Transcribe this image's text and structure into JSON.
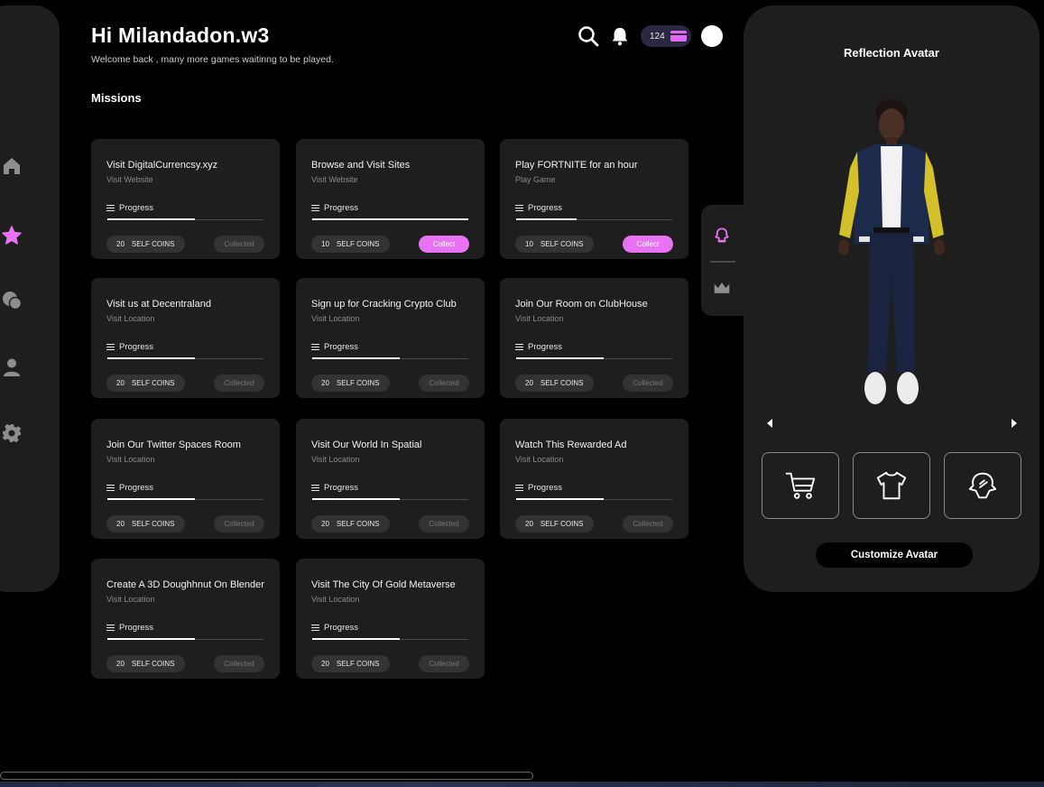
{
  "header": {
    "greeting": "Hi Milandadon.w3",
    "subtitle": "Welcome back , many more games waitinng to be played.",
    "coin_count": "124"
  },
  "section_title": "Missions",
  "missions": [
    {
      "title": "Visit DigitalCurrencsy.xyz",
      "subtitle": "Visit Website",
      "progress_label": "Progress",
      "progress": 0.56,
      "coins": "20",
      "coins_unit": "SELF COINS",
      "status": "Collected",
      "collectable": false
    },
    {
      "title": "Browse and Visit Sites",
      "subtitle": "Visit Website",
      "progress_label": "Progress",
      "progress": 1.0,
      "coins": "10",
      "coins_unit": "SELF COINS",
      "status": "Collect",
      "collectable": true
    },
    {
      "title": "Play FORTNITE for an hour",
      "subtitle": "Play Game",
      "progress_label": "Progress",
      "progress": 0.39,
      "coins": "10",
      "coins_unit": "SELF COINS",
      "status": "Collect",
      "collectable": true
    },
    {
      "title": "Visit us at Decentraland",
      "subtitle": "Visit Location",
      "progress_label": "Progress",
      "progress": 0.56,
      "coins": "20",
      "coins_unit": "SELF COINS",
      "status": "Collected",
      "collectable": false
    },
    {
      "title": "Sign up for Cracking Crypto Club",
      "subtitle": "Visit Location",
      "progress_label": "Progress",
      "progress": 0.56,
      "coins": "20",
      "coins_unit": "SELF COINS",
      "status": "Collected",
      "collectable": false
    },
    {
      "title": "Join Our Room on ClubHouse",
      "subtitle": "Visit Location",
      "progress_label": "Progress",
      "progress": 0.56,
      "coins": "20",
      "coins_unit": "SELF COINS",
      "status": "Collected",
      "collectable": false
    },
    {
      "title": "Join Our Twitter Spaces Room",
      "subtitle": "Visit Location",
      "progress_label": "Progress",
      "progress": 0.56,
      "coins": "20",
      "coins_unit": "SELF COINS",
      "status": "Collected",
      "collectable": false
    },
    {
      "title": "Visit Our World In Spatial",
      "subtitle": "Visit Location",
      "progress_label": "Progress",
      "progress": 0.56,
      "coins": "20",
      "coins_unit": "SELF COINS",
      "status": "Collected",
      "collectable": false
    },
    {
      "title": "Watch This Rewarded Ad",
      "subtitle": "Visit Location",
      "progress_label": "Progress",
      "progress": 0.56,
      "coins": "20",
      "coins_unit": "SELF COINS",
      "status": "Collected",
      "collectable": false
    },
    {
      "title": "Create A 3D Doughhnut On Blender",
      "subtitle": "Visit Location",
      "progress_label": "Progress",
      "progress": 0.56,
      "coins": "20",
      "coins_unit": "SELF COINS",
      "status": "Collected",
      "collectable": false
    },
    {
      "title": "Visit The City Of Gold Metaverse",
      "subtitle": "Visit Location",
      "progress_label": "Progress",
      "progress": 0.56,
      "coins": "20",
      "coins_unit": "SELF COINS",
      "status": "Collected",
      "collectable": false
    }
  ],
  "avatar_panel": {
    "title": "Reflection Avatar",
    "customize_label": "Customize Avatar"
  },
  "colors": {
    "accent": "#e872f4",
    "background": "#000000",
    "card": "#1e1e1e"
  },
  "icons": {
    "sidebar": [
      "home-icon",
      "star-icon",
      "chat-icon",
      "user-icon",
      "gear-icon"
    ],
    "header": [
      "search-icon",
      "bell-icon",
      "card-icon"
    ],
    "side_tab": [
      "avatar-icon",
      "crown-icon"
    ],
    "tiles": [
      "cart-icon",
      "tshirt-icon",
      "hat-icon"
    ]
  }
}
